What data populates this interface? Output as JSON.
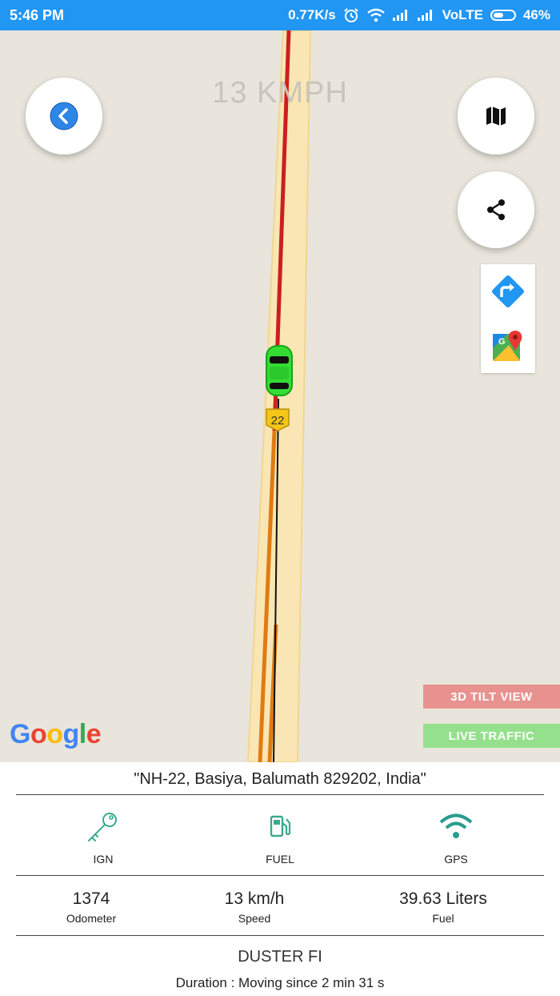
{
  "status_bar": {
    "time": "5:46 PM",
    "net_speed": "0.77K/s",
    "network": "VoLTE",
    "battery": "46%"
  },
  "map": {
    "speed_overlay": "13 KMPH",
    "road_shield": "22",
    "tilt_label": "3D TILT VIEW",
    "traffic_label": "LIVE TRAFFIC",
    "attribution": "Google",
    "icons": [
      "chevron-left-icon",
      "map-icon",
      "share-icon",
      "directions-icon",
      "google-maps-icon",
      "car-icon"
    ],
    "colors": {
      "tilt": "#e8928f",
      "traffic": "#94e08c",
      "route_traveled": "#cc1f1f",
      "route_ahead": "#e07b12",
      "car": "#33dd33"
    }
  },
  "details": {
    "address": "\"NH-22, Basiya, Balumath 829202, India\"",
    "indicators": [
      {
        "label": "IGN",
        "icon": "key-icon",
        "color": "#3aa98f"
      },
      {
        "label": "FUEL",
        "icon": "fuel-icon",
        "color": "#3aa98f"
      },
      {
        "label": "GPS",
        "icon": "wifi-icon",
        "color": "#2a9d8f"
      }
    ],
    "measures": [
      {
        "value": "1374",
        "caption": "Odometer"
      },
      {
        "value": "13 km/h",
        "caption": "Speed"
      },
      {
        "value": "39.63 Liters",
        "caption": "Fuel"
      }
    ],
    "vehicle_name": "DUSTER FI",
    "duration": "Duration : Moving  since 2 min 31 s"
  }
}
